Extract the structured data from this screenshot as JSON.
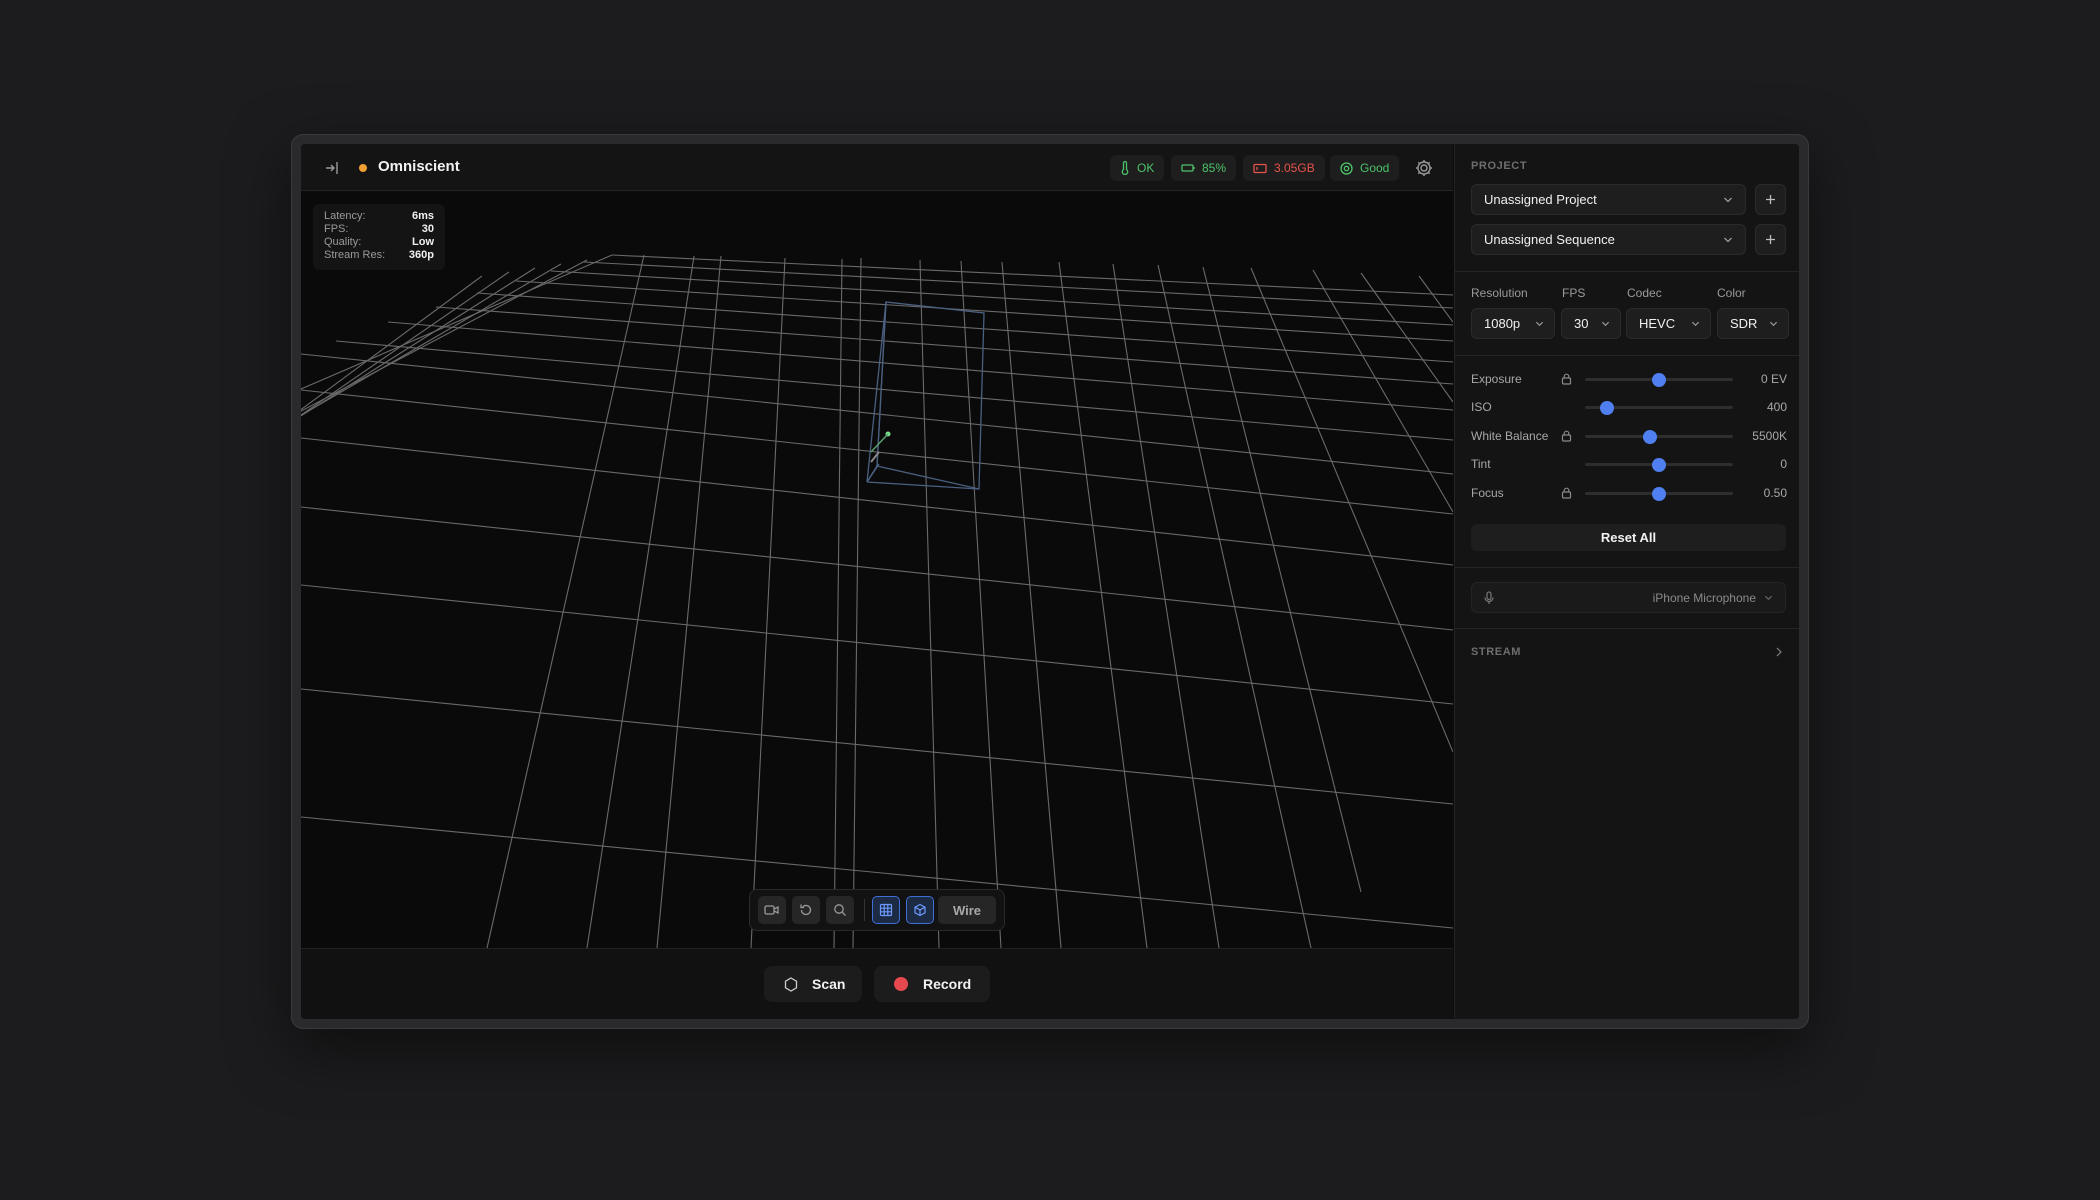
{
  "header": {
    "app_title": "Omniscient",
    "status": {
      "thermal": "OK",
      "battery": "85%",
      "storage": "3.05GB",
      "signal": "Good"
    }
  },
  "stats": {
    "latency_label": "Latency:",
    "latency": "6ms",
    "fps_label": "FPS:",
    "fps": "30",
    "quality_label": "Quality:",
    "quality": "Low",
    "res_label": "Stream Res:",
    "res": "360p"
  },
  "viewport_toolbar": {
    "wire_label": "Wire"
  },
  "actions": {
    "scan_label": "Scan",
    "record_label": "Record"
  },
  "sidebar": {
    "project_heading": "PROJECT",
    "project_value": "Unassigned Project",
    "sequence_value": "Unassigned Sequence",
    "format": {
      "resolution_label": "Resolution",
      "resolution_value": "1080p",
      "fps_label": "FPS",
      "fps_value": "30",
      "codec_label": "Codec",
      "codec_value": "HEVC",
      "color_label": "Color",
      "color_value": "SDR"
    },
    "sliders": [
      {
        "name": "Exposure",
        "value": "0 EV",
        "locked": true,
        "level": 0.5
      },
      {
        "name": "ISO",
        "value": "400",
        "locked": false,
        "level": 0.15
      },
      {
        "name": "White Balance",
        "value": "5500K",
        "locked": true,
        "level": 0.44
      },
      {
        "name": "Tint",
        "value": "0",
        "locked": false,
        "level": 0.5
      },
      {
        "name": "Focus",
        "value": "0.50",
        "locked": true,
        "level": 0.5
      }
    ],
    "reset_label": "Reset All",
    "microphone": "iPhone Microphone",
    "stream_heading": "STREAM"
  },
  "colors": {
    "accent": "#4f7ff0",
    "status_ok": "#4cc46a",
    "status_warn": "#e5534b",
    "record": "#e5484d",
    "indicator": "#f0a030"
  }
}
